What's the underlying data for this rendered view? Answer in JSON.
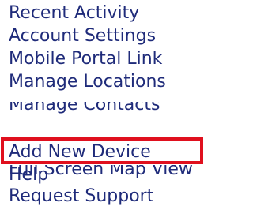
{
  "menu": {
    "items": [
      {
        "label": "Recent Activity"
      },
      {
        "label": "Account Settings"
      },
      {
        "label": "Mobile Portal Link"
      },
      {
        "label": "Manage Locations"
      },
      {
        "label": "Manage Contacts"
      },
      {
        "label": "Add New Device"
      },
      {
        "label": "Full Screen Map View"
      },
      {
        "label": "Help"
      },
      {
        "label": "Request Support"
      }
    ],
    "highlighted_item": "Add New Device"
  },
  "colors": {
    "link": "#1f2b7a",
    "highlight_border": "#e0101e",
    "background": "#ffffff"
  }
}
